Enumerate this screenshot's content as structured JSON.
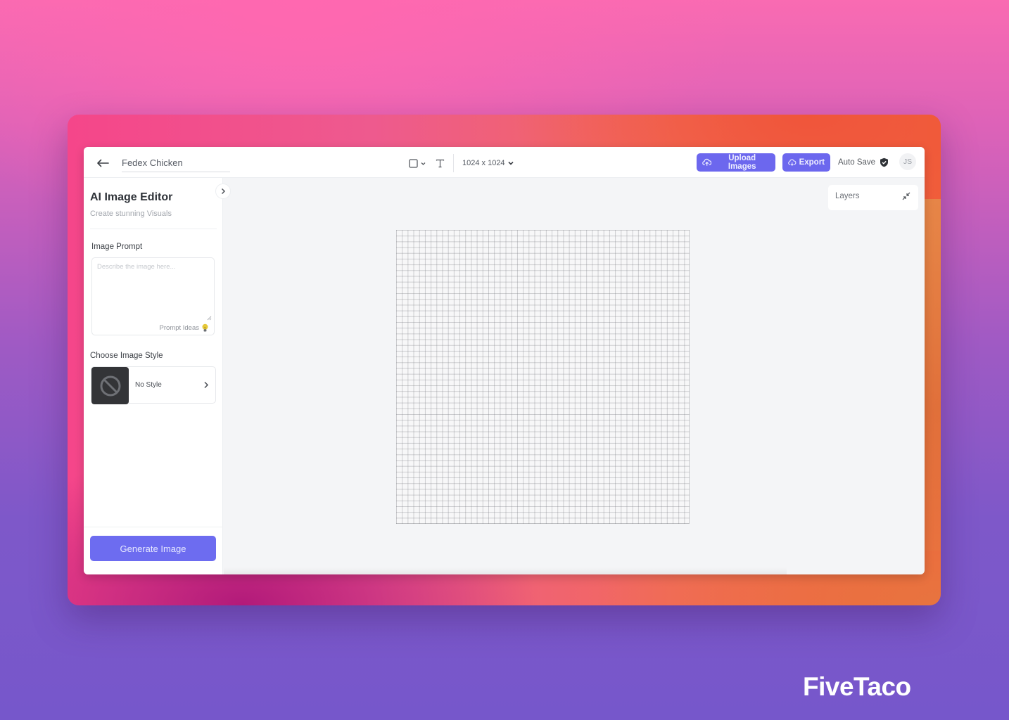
{
  "header": {
    "document_title": "Fedex Chicken",
    "canvas_size": "1024 x 1024",
    "upload_label": "Upload Images",
    "export_label": "Export",
    "autosave_label": "Auto Save",
    "user_initials": "JS"
  },
  "sidebar": {
    "title": "AI Image Editor",
    "subtitle": "Create stunning Visuals",
    "prompt_label": "Image Prompt",
    "prompt_placeholder": "Describe the image here...",
    "prompt_value": "",
    "prompt_ideas_label": "Prompt Ideas",
    "style_label": "Choose Image Style",
    "selected_style": "No Style",
    "generate_label": "Generate Image"
  },
  "canvas": {
    "layers_label": "Layers"
  },
  "brand": {
    "name": "FiveTaco"
  },
  "colors": {
    "primary": "#6c67ee",
    "style_thumb": "#333437",
    "canvas_bg": "#f4f5f7"
  },
  "icons": {
    "back": "arrow-left-icon",
    "shape_tool": "square-icon",
    "text_tool": "text-icon",
    "upload": "cloud-upload-icon",
    "export": "cloud-download-icon",
    "autosave": "shield-check-icon",
    "collapse": "chevron-right-icon",
    "prompt_ideas": "lightbulb-icon",
    "no_style": "ban-icon",
    "layers_toggle": "minimize-icon"
  }
}
